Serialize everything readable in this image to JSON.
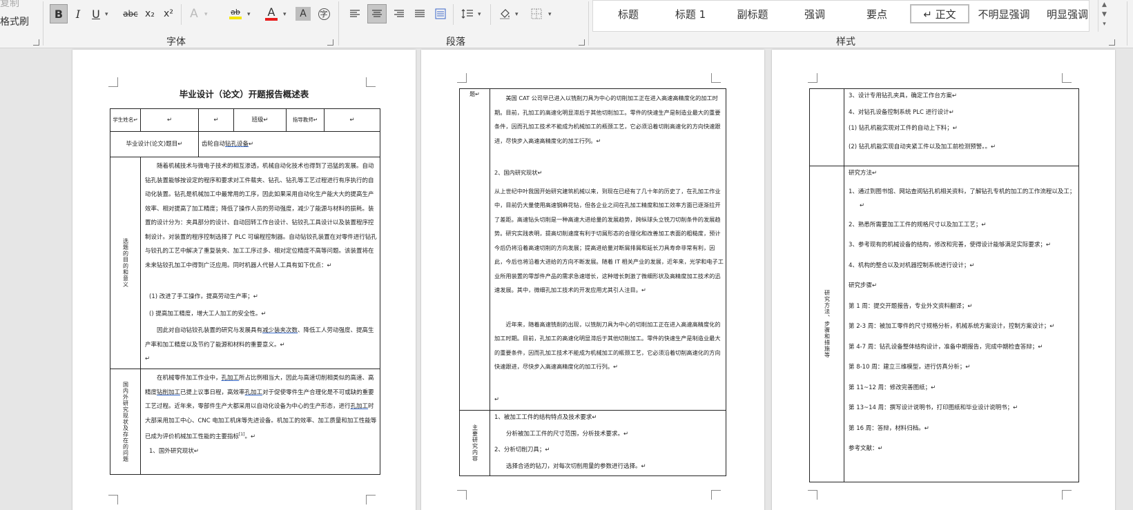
{
  "ribbon": {
    "clipboard": {
      "copy_label": "复制",
      "format_painter_label": "格式刷"
    },
    "font": {
      "label": "字体",
      "bold": "B",
      "italic": "I",
      "underline": "U",
      "strike": "abc",
      "subscript": "x₂",
      "superscript": "x²",
      "text_effect": "A",
      "highlight": "ab",
      "font_color": "A",
      "char_shading": "A",
      "enclose": "字"
    },
    "paragraph": {
      "label": "段落"
    },
    "styles": {
      "label": "样式",
      "items": [
        "标题",
        "标题 1",
        "副标题",
        "强调",
        "要点",
        "↵ 正文",
        "不明显强调",
        "明显强调"
      ]
    }
  },
  "page1": {
    "title": "毕业设计（论文）开题报告概述表",
    "row1": {
      "student_name": "学生姓名↵",
      "c2": "↵",
      "c3": "↵",
      "major": "班级↵",
      "advisor": "指导教师↵",
      "c6": "↵"
    },
    "row2": {
      "topic_label": "毕业设计(论文)题目↵",
      "topic_pre": "齿轮自动",
      "topic_hl": "钻孔设备",
      "topic_post": "↵"
    },
    "purpose_label": "选题的目的和意义",
    "purpose_p1_a": "随着机械技术与微电子技术的相互渗透，机械自动化技术也得到了迅猛的发展。自动钻孔装置能够按设定的程序和要求对工件载夹、钻孔、钻孔等工艺过程进行有序执行的自动化装置。钻孔是机械加工中最常用的工序，因此如果采用自动化生产能大大的提高生产效率、相对提高了加工精度；降低了操作人员的劳动强度，减少了能源与材料的损耗。装置的设计分为：夹具部分的设计、自动回转工作台设计、钻铰孔工具设计以及装置程序控制设计。对装置的程序控制选择了 PLC 可编程控制器。自动钻铰孔装置在对零件进行钻孔与铰孔的工艺中解决了重复装夹、加工工序过多、相对定位精度",
    "purpose_p1_b": "不高等问题。该装置将在未来钻铰孔加工中得到广泛应用。同时机器人代替人工具有如下优点：↵",
    "purpose_p2": "(1) 改进了手工操作，提高劳动生产率；↵",
    "purpose_p3": "() 提高加工精度，增大工人加工的安全性。↵",
    "purpose_p4_a": "因此对自动钻铰孔装置的研究与发展具有",
    "purpose_p4_hl": "减少装夹次数",
    "purpose_p4_b": "、降低工人劳动强度、提高生产率和加工精度以及节约了能源和材料的重要意义。↵",
    "purpose_p5": "↵",
    "status_label": "国内外研究现状及存在的问题",
    "status_p1_a": "在机械零件加工作业中，",
    "status_p1_hl1": "孔加工",
    "status_p1_b": "所占比例相当大，因此与高速切削相类似的高速、高精度",
    "status_p1_hl2": "钻削加工",
    "status_p1_c": "已提上议事日程，高效率",
    "status_p1_hl3": "孔加工",
    "status_p1_d": "对于促使零件生产合理化是不可或缺的重要工艺过程。近年来，零部件生产大都采用以自动化设备为中心的生产形态，进行",
    "status_p1_hl4": "孔加工",
    "status_p1_e": "时大部采用加工中心、CNC 电加工机床等先进设备。机加工的效率、加工质量和加工性能等已成为评价机械加工性能的主要指标",
    "status_p1_sup": "[1]",
    "status_p1_f": "。↵",
    "status_p2": "1、国外研究现状↵"
  },
  "page2": {
    "row1_label": "题↵",
    "p1": "美国 CAT 公司早已进入以铣削刀具为中心的切削加工正在进入高速高精度化的加工时期。目前，孔加工的高速化明显滞后于其他切削加工。零件的快速生产是制造业最大的重要条件，因而孔加工技术不能成为机械加工的瓶颈工艺，它必须沿着切削高速化的方向快速跟进，尽快步入高速高精度化的加工行列。↵",
    "p2": "2、国内研究现状↵",
    "p3": "从上世纪中叶我国开始研究建筑机械以来，到现在已经有了几十年的历史了，在孔加工作业中，目前仍大量使用高速钢麻花钻，但各企业之间在孔加工精度和加工效率方面已逐渐拉开了差距。高速钻头切削是一种高速大进给量的发展趋势，跨纵球头立铣刀切削条件的发展趋势。研究实践表明，提高切削速度有利于切屑形态的合理化和改善加工表面的粗糙度，预计今后仍将沿着高速切削的方向发展；提高进给量对断屑排屑和延长刀具寿命非常有利，因此，今后也将沿着大进给的方向不断发展。随着 IT 相关产业的发展，近年来，光学和电子工业所用装置的零部件产品的需求急速增长，这种增长刺激了微细形状及高精度加工技术的迅速发展。其中，微细孔加工技术的开发应用尤其引人注目。↵",
    "p4": "近年来，随着高速铣削的出现，以铣削刀具为中心的切削加工正在进入高速高精度化的加工时期。目前，孔加工的高速化明显滞后于其他切削加工。零件的快速生产是制造业最大的重要条件，因而孔加工技术不能成为机械加工的瓶颈工艺，它必须沿着切削高速化的方向快速跟进，尽快步入高速高精度化的加工行列。↵",
    "p5": "↵",
    "content_label": "主要研究内容",
    "c1": "1、被加工工件的结构特点及技术要求↵",
    "c2": "分析被加工工件的尺寸范围，分析技术要求。↵",
    "c3": "2、分析切削刀具；↵",
    "c4": "选择合适的钻刀，对每次切削用量的参数进行选择。↵"
  },
  "page3": {
    "r1": [
      "3、设计专用钻孔夹具，确定工作台方案↵",
      "4、对钻孔设备控制系统 PLC 进行设计↵",
      "(1) 钻孔机能实现对工件的自动上下料；↵",
      "(2) 钻孔机能实现自动夹紧工件以及加工前检测预警。。↵"
    ],
    "method_label": "研究方法、步骤和措施等",
    "r2": [
      "研究方法↵",
      "1、通过到图书馆、网站查阅钻孔机相关资料，了解钻孔专机的加工的工作流程以及工；↵",
      "2、熟悉所需要加工工件的规格尺寸以及加工工艺；↵",
      "3、参考现有的机械设备的结构，修改和完善，使得设计能够满足实际要求；↵",
      "4、机构的整合以及对机器控制系统进行设计；↵",
      "研究步骤↵",
      "第 1 周：提交开题报告，专业外文资料翻译；↵",
      "第 2-3 周：被加工零件的尺寸规格分析，机械系统方案设计，控制方案设计；↵",
      "第 4-7 周：钻孔设备整体结构设计，准备中期报告，完成中期检查答辩；↵",
      "第 8-10 周：建立三维模型，进行仿真分析；↵",
      "第 11~12 周：修改完善图纸；↵",
      "第 13~14 周：撰写设计说明书，打印图纸和毕业设计说明书；↵",
      "第 16 周：答辩，材料归档。↵",
      "参考文献：↵"
    ]
  },
  "colors": {
    "ribbon_bg": "#f3f3f3",
    "workspace_bg": "#e6e6e6",
    "highlight_bar": "#f5e600",
    "font_color_bar": "#e81c1c",
    "link_underline": "#3c6fd0"
  }
}
